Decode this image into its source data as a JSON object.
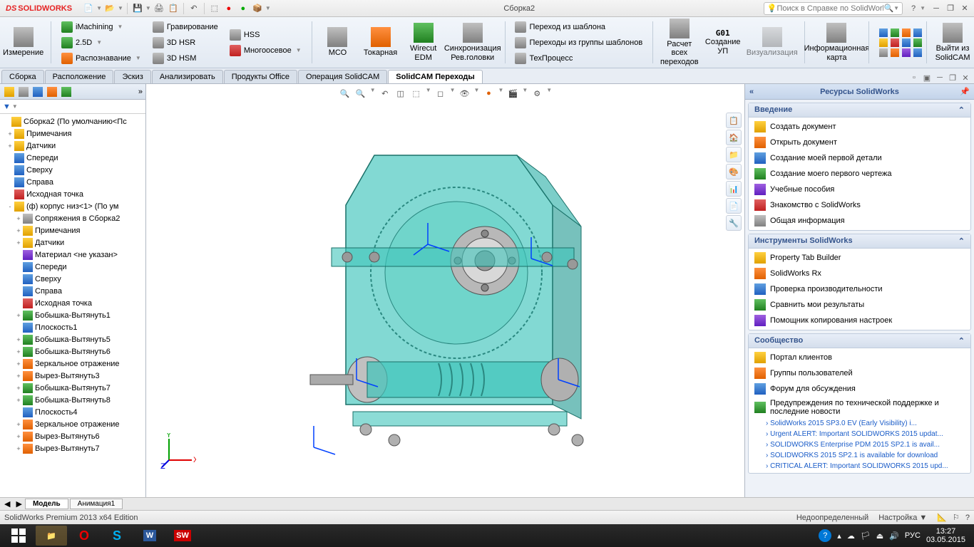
{
  "app": {
    "name": "SOLIDWORKS",
    "doc_title": "Сборка2"
  },
  "qat": {
    "search_placeholder": "Поиск в Справке по SolidWorks"
  },
  "ribbon": {
    "measure": "Измерение",
    "imach": "iMachining",
    "d25": "2.5D",
    "recog": "Распознавание",
    "grav": "Гравирование",
    "hsr": "3D HSR",
    "hsm": "3D HSM",
    "hss": "HSS",
    "multi": "Многоосевое",
    "mco": "МСО",
    "turn": "Токарная",
    "edm": "Wirecut EDM",
    "sync": "Синхронизация Рев.головки",
    "tmpl": "Переход из шаблона",
    "grp_tmpl": "Переходы из группы шаблонов",
    "tech": "ТехПроцесс",
    "calc": "Расчет всех переходов",
    "create": "Создание УП",
    "viz": "Визуализация",
    "info": "Информационная карта",
    "exit": "Выйти из SolidCAM"
  },
  "tabs": {
    "t1": "Сборка",
    "t2": "Расположение",
    "t3": "Эскиз",
    "t4": "Анализировать",
    "t5": "Продукты Office",
    "t6": "Операция SolidCAM",
    "t7": "SolidCAM Переходы"
  },
  "tree": {
    "root": "Сборка2  (По умолчанию<Пс",
    "items": [
      {
        "lvl": 1,
        "ic": "yel",
        "exp": "+",
        "t": "Примечания"
      },
      {
        "lvl": 1,
        "ic": "yel",
        "exp": "+",
        "t": "Датчики"
      },
      {
        "lvl": 1,
        "ic": "blu",
        "exp": "",
        "t": "Спереди"
      },
      {
        "lvl": 1,
        "ic": "blu",
        "exp": "",
        "t": "Сверху"
      },
      {
        "lvl": 1,
        "ic": "blu",
        "exp": "",
        "t": "Справа"
      },
      {
        "lvl": 1,
        "ic": "red",
        "exp": "",
        "t": "Исходная точка"
      },
      {
        "lvl": 1,
        "ic": "yel",
        "exp": "-",
        "t": "(ф) корпус низ<1> (По ум"
      },
      {
        "lvl": 2,
        "ic": "gry",
        "exp": "+",
        "t": "Сопряжения в Сборка2"
      },
      {
        "lvl": 2,
        "ic": "yel",
        "exp": "+",
        "t": "Примечания"
      },
      {
        "lvl": 2,
        "ic": "yel",
        "exp": "+",
        "t": "Датчики"
      },
      {
        "lvl": 2,
        "ic": "prp",
        "exp": "",
        "t": "Материал <не указан>"
      },
      {
        "lvl": 2,
        "ic": "blu",
        "exp": "",
        "t": "Спереди"
      },
      {
        "lvl": 2,
        "ic": "blu",
        "exp": "",
        "t": "Сверху"
      },
      {
        "lvl": 2,
        "ic": "blu",
        "exp": "",
        "t": "Справа"
      },
      {
        "lvl": 2,
        "ic": "red",
        "exp": "",
        "t": "Исходная точка"
      },
      {
        "lvl": 2,
        "ic": "grn",
        "exp": "+",
        "t": "Бобышка-Вытянуть1"
      },
      {
        "lvl": 2,
        "ic": "blu",
        "exp": "",
        "t": "Плоскость1"
      },
      {
        "lvl": 2,
        "ic": "grn",
        "exp": "+",
        "t": "Бобышка-Вытянуть5"
      },
      {
        "lvl": 2,
        "ic": "grn",
        "exp": "+",
        "t": "Бобышка-Вытянуть6"
      },
      {
        "lvl": 2,
        "ic": "org",
        "exp": "+",
        "t": "Зеркальное отражение"
      },
      {
        "lvl": 2,
        "ic": "org",
        "exp": "+",
        "t": "Вырез-Вытянуть3"
      },
      {
        "lvl": 2,
        "ic": "grn",
        "exp": "+",
        "t": "Бобышка-Вытянуть7"
      },
      {
        "lvl": 2,
        "ic": "grn",
        "exp": "+",
        "t": "Бобышка-Вытянуть8"
      },
      {
        "lvl": 2,
        "ic": "blu",
        "exp": "",
        "t": "Плоскость4"
      },
      {
        "lvl": 2,
        "ic": "org",
        "exp": "+",
        "t": "Зеркальное отражение"
      },
      {
        "lvl": 2,
        "ic": "org",
        "exp": "+",
        "t": "Вырез-Вытянуть6"
      },
      {
        "lvl": 2,
        "ic": "org",
        "exp": "+",
        "t": "Вырез-Вытянуть7"
      }
    ]
  },
  "taskpane": {
    "title": "Ресурсы SolidWorks",
    "s1": {
      "hdr": "Введение",
      "items": [
        "Создать документ",
        "Открыть документ",
        "Создание моей первой детали",
        "Создание моего первого чертежа",
        "Учебные пособия",
        "Знакомство с SolidWorks",
        "Общая информация"
      ]
    },
    "s2": {
      "hdr": "Инструменты SolidWorks",
      "items": [
        "Property Tab Builder",
        "SolidWorks Rx",
        "Проверка производительности",
        "Сравнить мои результаты",
        "Помощник копирования настроек"
      ]
    },
    "s3": {
      "hdr": "Сообщество",
      "items": [
        "Портал клиентов",
        "Группы пользователей",
        "Форум для обсуждения",
        "Предупреждения по технической поддержке и последние новости"
      ],
      "news": [
        "SolidWorks 2015 SP3.0 EV (Early Visibility) i...",
        "Urgent ALERT: Important SOLIDWORKS 2015 updat...",
        "SOLIDWORKS Enterprise PDM 2015 SP2.1 is avail...",
        "SOLIDWORKS 2015 SP2.1 is available for download",
        "CRITICAL ALERT: Important SOLIDWORKS 2015 upd..."
      ]
    }
  },
  "bottom_tabs": {
    "t1": "Модель",
    "t2": "Анимация1"
  },
  "status": {
    "edition": "SolidWorks Premium 2013 x64 Edition",
    "state": "Недоопределенный",
    "edit": "Настройка",
    "lang": "РУС"
  },
  "tray": {
    "time": "13:27",
    "date": "03.05.2015"
  }
}
